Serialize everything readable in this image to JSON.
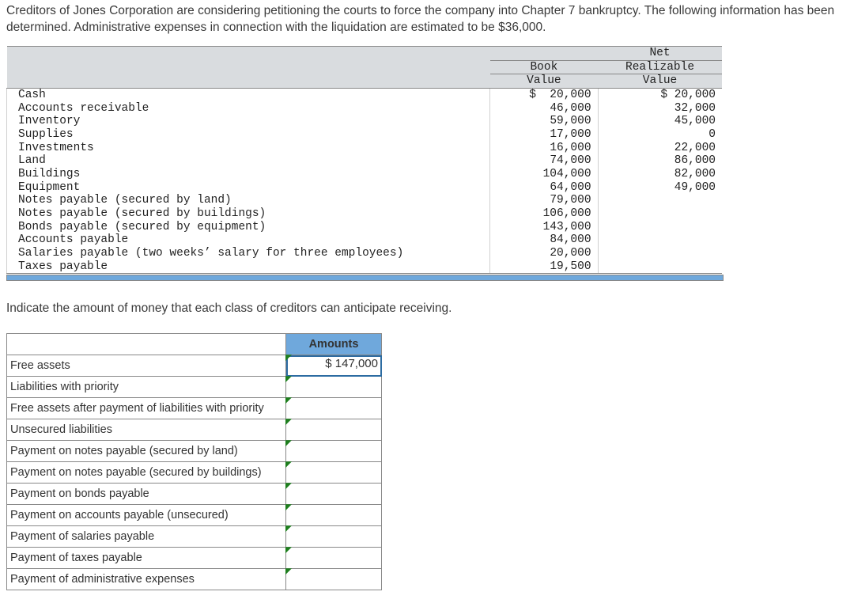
{
  "intro": "Creditors of Jones Corporation are considering petitioning the courts to force the company into Chapter 7 bankruptcy. The following information has been determined. Administrative expenses in connection with the liquidation are estimated to be $36,000.",
  "ledger": {
    "header": {
      "blank": "",
      "bv1": "Book",
      "bv2": "Value",
      "nr0": "Net",
      "nr1": "Realizable",
      "nr2": "Value"
    },
    "rows": [
      {
        "label": "Cash",
        "book": "$  20,000",
        "nrv": "$ 20,000"
      },
      {
        "label": "Accounts receivable",
        "book": "46,000",
        "nrv": "32,000"
      },
      {
        "label": "Inventory",
        "book": "59,000",
        "nrv": "45,000"
      },
      {
        "label": "Supplies",
        "book": "17,000",
        "nrv": "0"
      },
      {
        "label": "Investments",
        "book": "16,000",
        "nrv": "22,000"
      },
      {
        "label": "Land",
        "book": "74,000",
        "nrv": "86,000"
      },
      {
        "label": "Buildings",
        "book": "104,000",
        "nrv": "82,000"
      },
      {
        "label": "Equipment",
        "book": "64,000",
        "nrv": "49,000"
      },
      {
        "label": "Notes payable (secured by land)",
        "book": "79,000",
        "nrv": ""
      },
      {
        "label": "Notes payable (secured by buildings)",
        "book": "106,000",
        "nrv": ""
      },
      {
        "label": "Bonds payable (secured by equipment)",
        "book": "143,000",
        "nrv": ""
      },
      {
        "label": "Accounts payable",
        "book": "84,000",
        "nrv": ""
      },
      {
        "label": "Salaries payable (two weeks’ salary for three employees)",
        "book": "20,000",
        "nrv": ""
      },
      {
        "label": "Taxes payable",
        "book": "19,500",
        "nrv": ""
      }
    ]
  },
  "instruction": "Indicate the amount of money that each class of creditors can anticipate receiving.",
  "answer": {
    "header_amounts": "Amounts",
    "rows": [
      {
        "label": "Free assets",
        "value": "$ 147,000",
        "active": true
      },
      {
        "label": "Liabilities with priority",
        "value": ""
      },
      {
        "label": "Free assets after payment of liabilities with priority",
        "value": ""
      },
      {
        "label": "Unsecured liabilities",
        "value": ""
      },
      {
        "label": "Payment on notes payable (secured by land)",
        "value": ""
      },
      {
        "label": "Payment on notes payable (secured by buildings)",
        "value": ""
      },
      {
        "label": "Payment on bonds payable",
        "value": ""
      },
      {
        "label": "Payment on accounts payable (unsecured)",
        "value": ""
      },
      {
        "label": "Payment of salaries payable",
        "value": ""
      },
      {
        "label": "Payment of taxes payable",
        "value": ""
      },
      {
        "label": "Payment of administrative expenses",
        "value": ""
      }
    ]
  }
}
